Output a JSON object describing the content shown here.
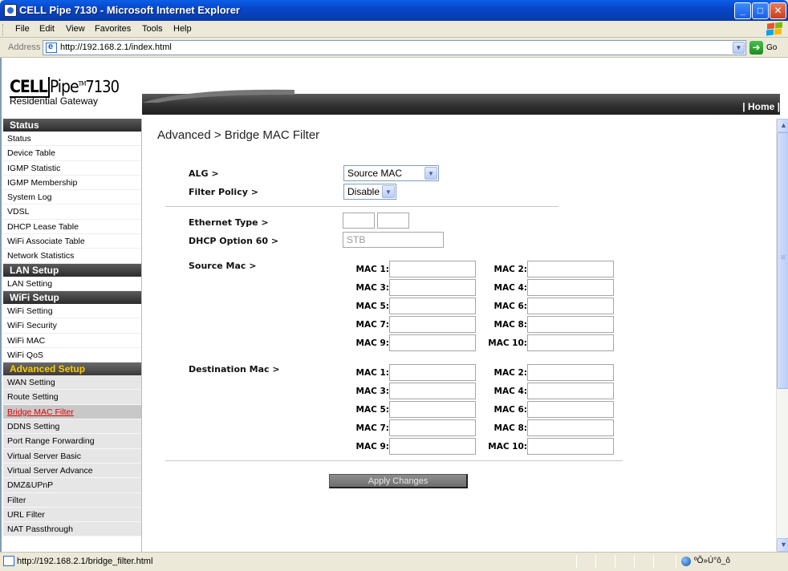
{
  "window": {
    "title": "CELL Pipe 7130 - Microsoft Internet Explorer"
  },
  "menu": [
    "File",
    "Edit",
    "View",
    "Favorites",
    "Tools",
    "Help"
  ],
  "address": {
    "label": "Address",
    "url": "http://192.168.2.1/index.html",
    "go": "Go"
  },
  "header": {
    "brand_cell": "CELL",
    "brand_pipe": "Pipe",
    "brand_tm": "TM",
    "brand_model": "7130",
    "tagline": "Residential Gateway",
    "home": "| Home |"
  },
  "sidebar": {
    "sections": [
      {
        "title": "Status",
        "items": [
          "Status",
          "Device Table",
          "IGMP Statistic",
          "IGMP Membership",
          "System Log",
          "VDSL",
          "DHCP Lease Table",
          "WiFi Associate Table",
          "Network Statistics"
        ]
      },
      {
        "title": "LAN Setup",
        "items": [
          "LAN Setting"
        ]
      },
      {
        "title": "WiFi Setup",
        "items": [
          "WiFi Setting",
          "WiFi Security",
          "WiFi MAC",
          "WiFi QoS"
        ]
      },
      {
        "title": "Advanced Setup",
        "items": [
          "WAN Setting",
          "Route Setting",
          "Bridge MAC Filter",
          "DDNS Setting",
          "Port Range Forwarding",
          "Virtual Server Basic",
          "Virtual Server Advance",
          "DMZ&UPnP",
          "Filter",
          "URL Filter",
          "NAT Passthrough"
        ]
      }
    ],
    "active_item": "Bridge MAC Filter"
  },
  "main": {
    "title": "Advanced > Bridge MAC Filter",
    "alg_label": "ALG >",
    "alg_value": "Source MAC",
    "policy_label": "Filter Policy >",
    "policy_value": "Disable",
    "ethertype_label": "Ethernet Type >",
    "dhcp60_label": "DHCP Option 60 >",
    "dhcp60_value": "STB",
    "source_label": "Source Mac >",
    "dest_label": "Destination Mac >",
    "mac_labels": [
      "MAC 1:",
      "MAC 2:",
      "MAC 3:",
      "MAC 4:",
      "MAC 5:",
      "MAC 6:",
      "MAC 7:",
      "MAC 8:",
      "MAC 9:",
      "MAC 10:"
    ],
    "apply_label": "Apply Changes"
  },
  "status_bar": {
    "text": "http://192.168.2.1/bridge_filter.html",
    "zone": "ºÕ»Ú°ô_ô"
  },
  "colors": {
    "title_bar": "#0846c8",
    "active_link": "#e00000",
    "advanced_heading": "#ffcc00"
  }
}
